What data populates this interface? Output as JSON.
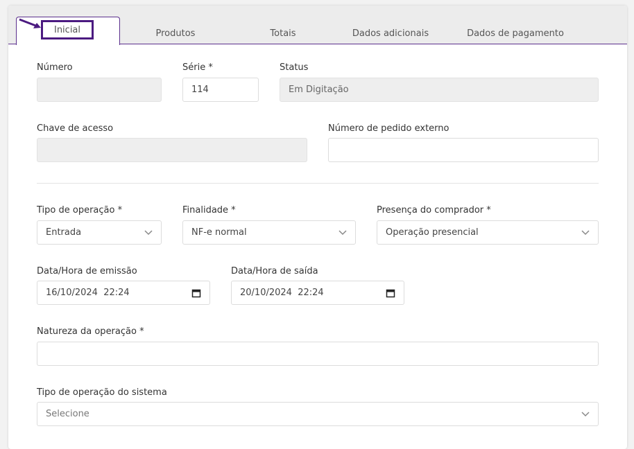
{
  "tabs": [
    {
      "label": "Inicial",
      "active": true
    },
    {
      "label": "Produtos"
    },
    {
      "label": "Totais"
    },
    {
      "label": "Dados adicionais"
    },
    {
      "label": "Dados de pagamento"
    }
  ],
  "form": {
    "numero": {
      "label": "Número",
      "value": ""
    },
    "serie": {
      "label": "Série *",
      "value": "114"
    },
    "status": {
      "label": "Status",
      "value": "Em Digitação"
    },
    "chave": {
      "label": "Chave de acesso",
      "value": ""
    },
    "pedido_externo": {
      "label": "Número de pedido externo",
      "value": ""
    },
    "tipo_operacao": {
      "label": "Tipo de operação *",
      "value": "Entrada"
    },
    "finalidade": {
      "label": "Finalidade *",
      "value": "NF-e normal"
    },
    "presenca": {
      "label": "Presença do comprador *",
      "value": "Operação presencial"
    },
    "data_emissao": {
      "label": "Data/Hora de emissão",
      "value": "16/10/2024  22:24"
    },
    "data_saida": {
      "label": "Data/Hora de saída",
      "value": "20/10/2024  22:24"
    },
    "natureza": {
      "label": "Natureza da operação *",
      "value": ""
    },
    "tipo_sistema": {
      "label": "Tipo de operação do sistema",
      "placeholder": "Selecione"
    }
  },
  "colors": {
    "accent": "#5a2e8c",
    "highlight": "#4b1a80"
  },
  "icons": [
    "arrow-annotation-icon",
    "chevron-down-icon",
    "calendar-icon"
  ]
}
